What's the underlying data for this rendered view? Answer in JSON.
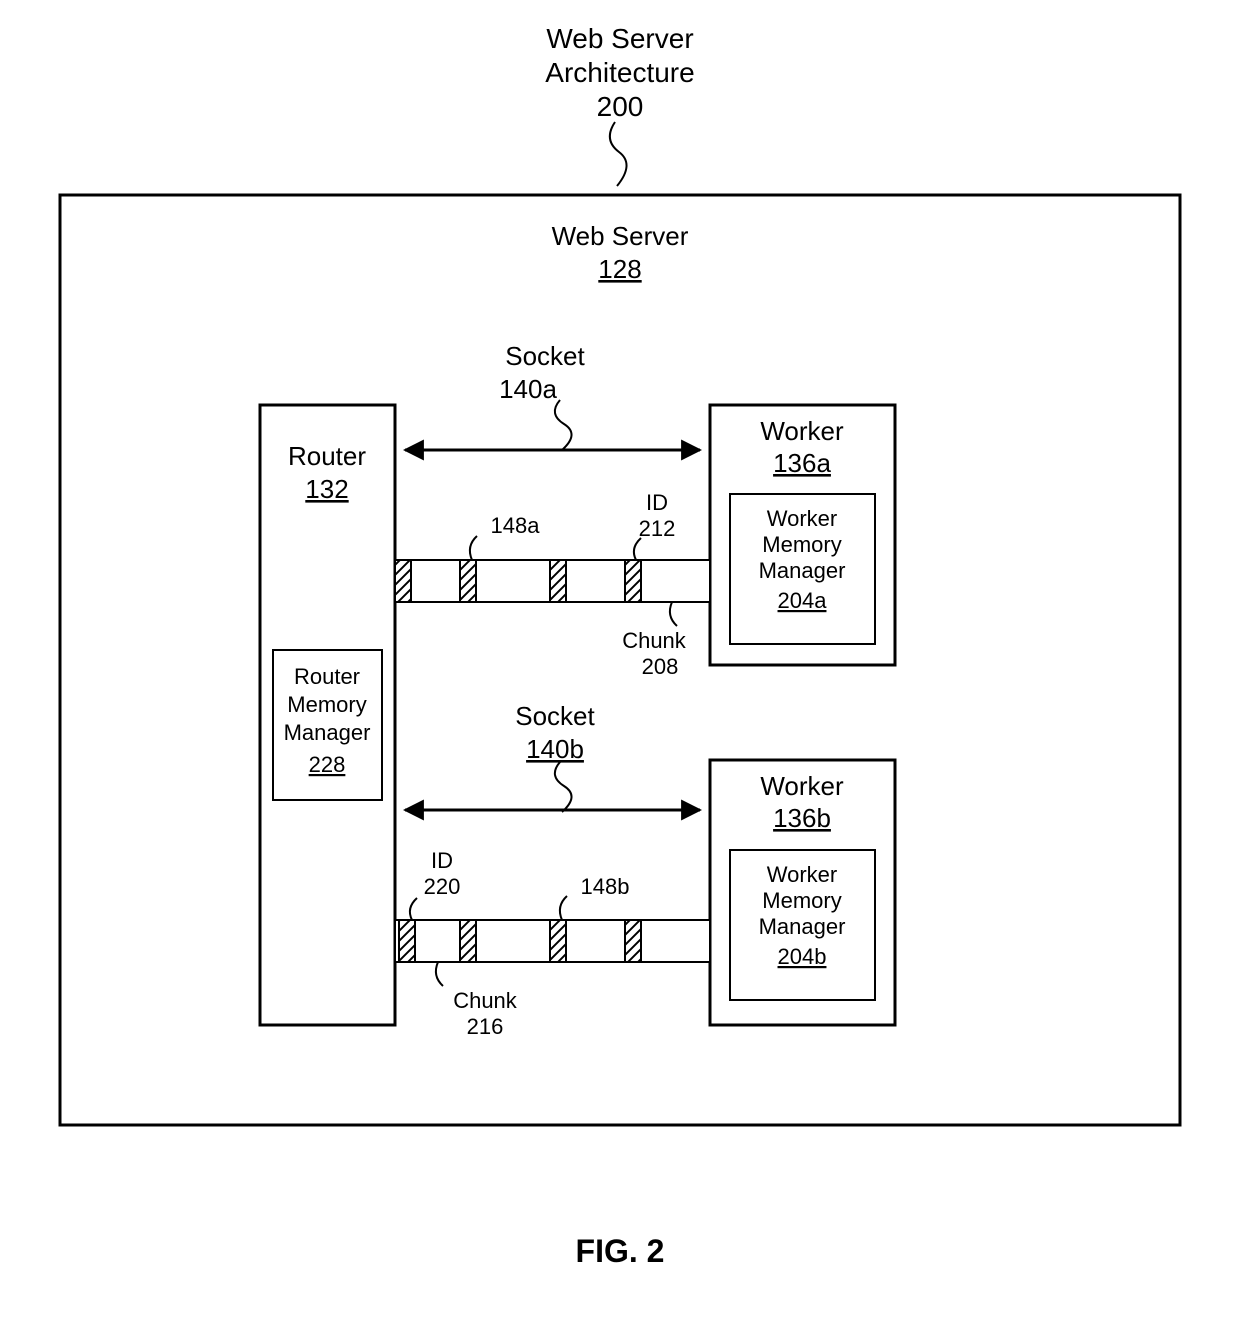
{
  "title": {
    "line1": "Web Server",
    "line2": "Architecture",
    "ref": "200"
  },
  "webserver": {
    "label": "Web Server",
    "ref": "128"
  },
  "router": {
    "label": "Router",
    "ref": "132"
  },
  "routerMem": {
    "l1": "Router",
    "l2": "Memory",
    "l3": "Manager",
    "ref": "228"
  },
  "socketA": {
    "label": "Socket",
    "ref": "140a"
  },
  "socketB": {
    "label": "Socket",
    "ref": "140b"
  },
  "workerA": {
    "label": "Worker",
    "ref": "136a"
  },
  "workerB": {
    "label": "Worker",
    "ref": "136b"
  },
  "wMemA": {
    "l1": "Worker",
    "l2": "Memory",
    "l3": "Manager",
    "ref": "204a"
  },
  "wMemB": {
    "l1": "Worker",
    "l2": "Memory",
    "l3": "Manager",
    "ref": "204b"
  },
  "sharedA": {
    "ref": "148a"
  },
  "sharedB": {
    "ref": "148b"
  },
  "idA": {
    "label": "ID",
    "ref": "212"
  },
  "chunkA": {
    "label": "Chunk",
    "ref": "208"
  },
  "idB": {
    "label": "ID",
    "ref": "220"
  },
  "chunkB": {
    "label": "Chunk",
    "ref": "216"
  },
  "figure": "FIG. 2"
}
